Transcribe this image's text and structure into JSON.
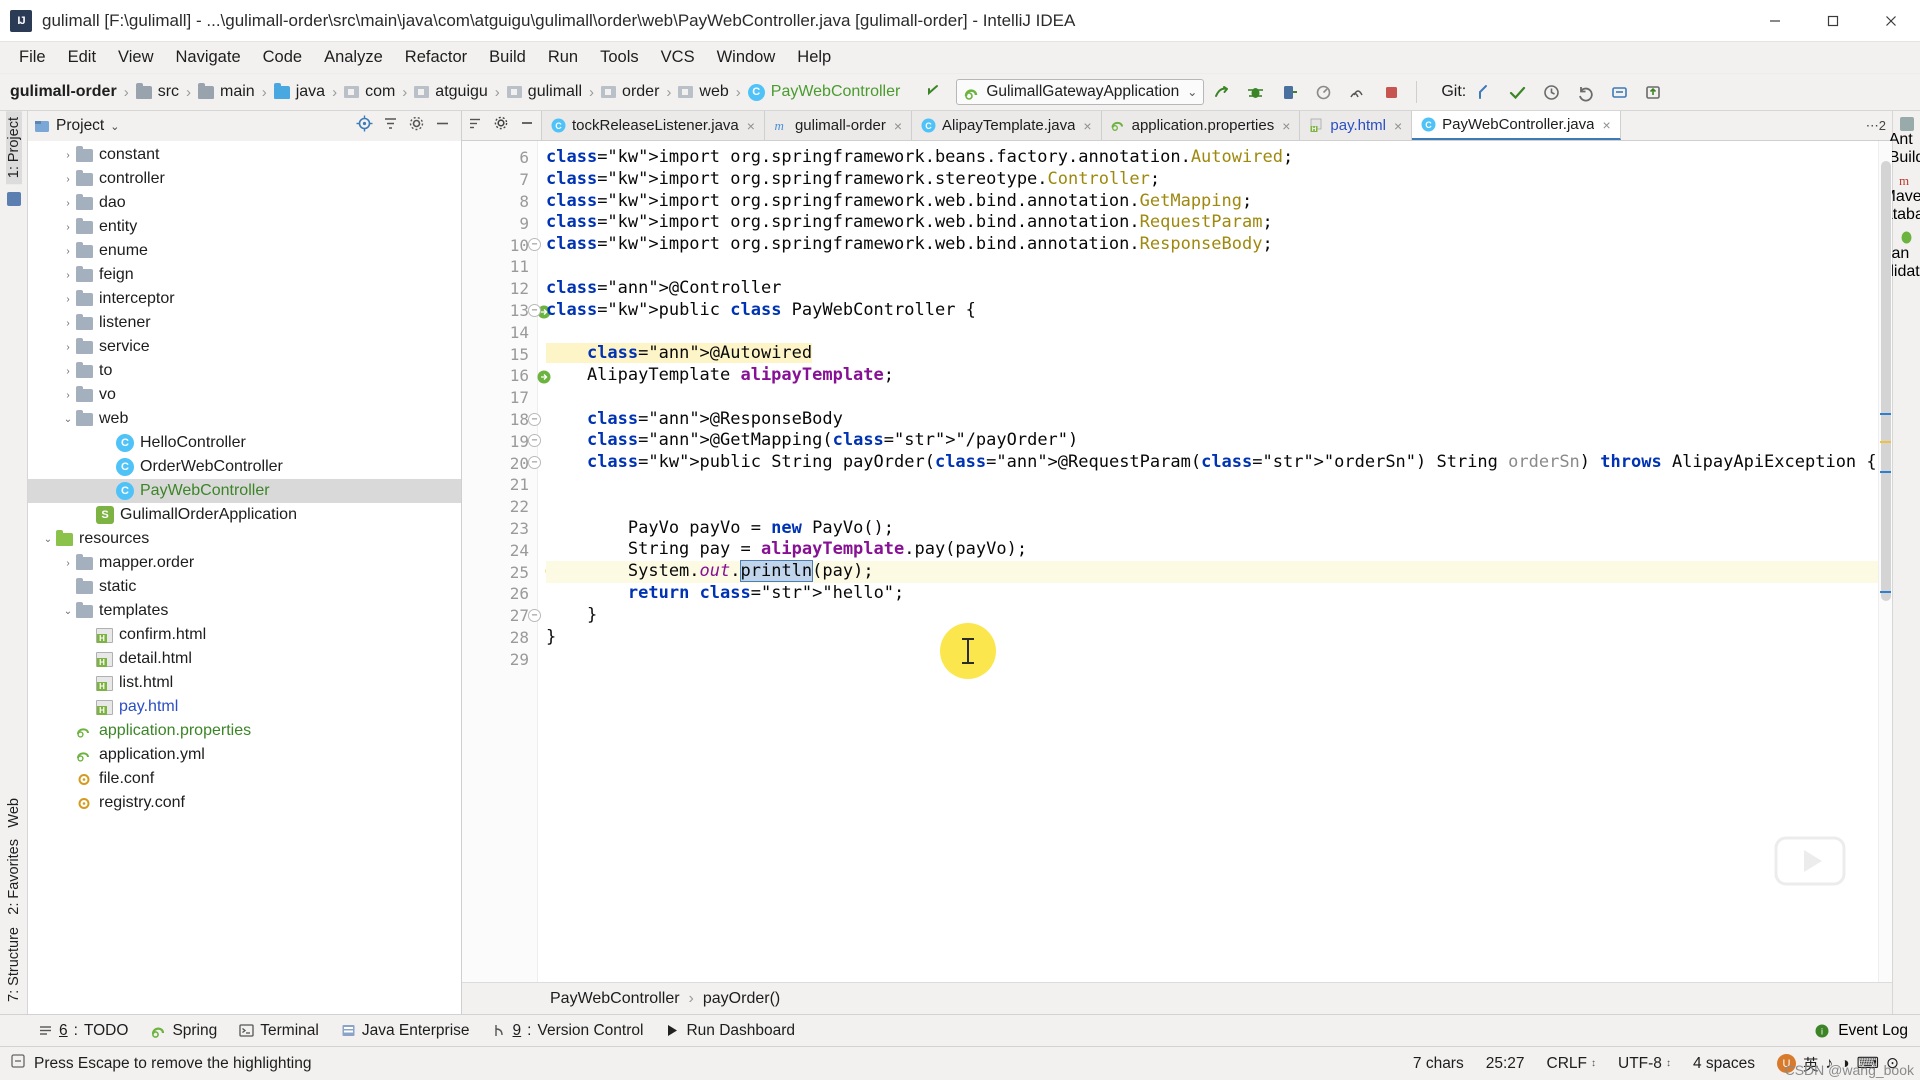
{
  "window": {
    "title": "gulimall [F:\\gulimall] - ...\\gulimall-order\\src\\main\\java\\com\\atguigu\\gulimall\\order\\web\\PayWebController.java [gulimall-order] - IntelliJ IDEA",
    "logo_text": "IJ",
    "minimize": "minimize-icon",
    "maximize": "maximize-icon",
    "close": "close-icon"
  },
  "menubar": {
    "items": [
      "File",
      "Edit",
      "View",
      "Navigate",
      "Code",
      "Analyze",
      "Refactor",
      "Build",
      "Run",
      "Tools",
      "VCS",
      "Window",
      "Help"
    ]
  },
  "navbar": {
    "crumbs": [
      {
        "label": "gulimall-order",
        "icon": "none",
        "bold": true
      },
      {
        "label": "src",
        "icon": "folder-src"
      },
      {
        "label": "main",
        "icon": "folder-src"
      },
      {
        "label": "java",
        "icon": "folder-blue"
      },
      {
        "label": "com",
        "icon": "package"
      },
      {
        "label": "atguigu",
        "icon": "package"
      },
      {
        "label": "gulimall",
        "icon": "package"
      },
      {
        "label": "order",
        "icon": "package"
      },
      {
        "label": "web",
        "icon": "package"
      },
      {
        "label": "PayWebController",
        "icon": "class",
        "cls": true
      }
    ],
    "run_config": {
      "name": "GulimallGatewayApplication",
      "icon": "spring-boot-icon",
      "chevron": "⌄"
    },
    "actions": [
      "run-icon",
      "debug-icon",
      "run-with-coverage-icon",
      "profile-icon",
      "build-icon",
      "stop-icon"
    ],
    "git_label": "Git:",
    "git_actions": [
      "update-project-icon",
      "commit-icon",
      "history-icon",
      "rollback-icon",
      "branch-icon",
      "push-icon"
    ]
  },
  "left_rail": {
    "top": [
      "1: Project"
    ],
    "bottom": [
      "★",
      "2: Favorites",
      "7: Structure",
      "Web"
    ]
  },
  "right_rail": {
    "items": [
      "Ant Build",
      "Maven",
      "Database",
      "Bean Validation"
    ]
  },
  "project_panel": {
    "title": "Project",
    "chevron": "⌄",
    "actions": [
      "locate-icon",
      "collapse-all-icon",
      "settings-icon",
      "hide-icon"
    ],
    "tree": [
      {
        "label": "constant",
        "icon": "folder",
        "arrow": "›",
        "indent": 4,
        "color": ""
      },
      {
        "label": "controller",
        "icon": "folder",
        "arrow": "›",
        "indent": 4,
        "color": ""
      },
      {
        "label": "dao",
        "icon": "folder",
        "arrow": "›",
        "indent": 4,
        "color": ""
      },
      {
        "label": "entity",
        "icon": "folder",
        "arrow": "›",
        "indent": 4,
        "color": ""
      },
      {
        "label": "enume",
        "icon": "folder",
        "arrow": "›",
        "indent": 4,
        "color": ""
      },
      {
        "label": "feign",
        "icon": "folder",
        "arrow": "›",
        "indent": 4,
        "color": ""
      },
      {
        "label": "interceptor",
        "icon": "folder",
        "arrow": "›",
        "indent": 4,
        "color": ""
      },
      {
        "label": "listener",
        "icon": "folder",
        "arrow": "›",
        "indent": 4,
        "color": ""
      },
      {
        "label": "service",
        "icon": "folder",
        "arrow": "›",
        "indent": 4,
        "color": ""
      },
      {
        "label": "to",
        "icon": "folder",
        "arrow": "›",
        "indent": 4,
        "color": ""
      },
      {
        "label": "vo",
        "icon": "folder",
        "arrow": "›",
        "indent": 4,
        "color": ""
      },
      {
        "label": "web",
        "icon": "folder",
        "arrow": "⌄",
        "indent": 4,
        "color": ""
      },
      {
        "label": "HelloController",
        "icon": "class",
        "arrow": "",
        "indent": 6,
        "color": ""
      },
      {
        "label": "OrderWebController",
        "icon": "class",
        "arrow": "",
        "indent": 6,
        "color": ""
      },
      {
        "label": "PayWebController",
        "icon": "class",
        "arrow": "",
        "indent": 6,
        "color": "green",
        "selected": true
      },
      {
        "label": "GulimallOrderApplication",
        "icon": "spring",
        "arrow": "",
        "indent": 5,
        "color": ""
      },
      {
        "label": "resources",
        "icon": "folder-green",
        "arrow": "⌄",
        "indent": 3,
        "color": ""
      },
      {
        "label": "mapper.order",
        "icon": "folder",
        "arrow": "›",
        "indent": 4,
        "color": ""
      },
      {
        "label": "static",
        "icon": "folder",
        "arrow": "",
        "indent": 4,
        "color": ""
      },
      {
        "label": "templates",
        "icon": "folder",
        "arrow": "⌄",
        "indent": 4,
        "color": ""
      },
      {
        "label": "confirm.html",
        "icon": "html",
        "arrow": "",
        "indent": 5,
        "color": ""
      },
      {
        "label": "detail.html",
        "icon": "html",
        "arrow": "",
        "indent": 5,
        "color": ""
      },
      {
        "label": "list.html",
        "icon": "html",
        "arrow": "",
        "indent": 5,
        "color": ""
      },
      {
        "label": "pay.html",
        "icon": "html",
        "arrow": "",
        "indent": 5,
        "color": "blue"
      },
      {
        "label": "application.properties",
        "icon": "props",
        "arrow": "",
        "indent": 4,
        "color": "green"
      },
      {
        "label": "application.yml",
        "icon": "props",
        "arrow": "",
        "indent": 4,
        "color": ""
      },
      {
        "label": "file.conf",
        "icon": "conf",
        "arrow": "",
        "indent": 4,
        "color": ""
      },
      {
        "label": "registry.conf",
        "icon": "conf",
        "arrow": "",
        "indent": 4,
        "color": ""
      }
    ]
  },
  "editor": {
    "tabs": [
      {
        "label": "tockReleaseListener.java",
        "icon": "class",
        "active": false,
        "truncated": true
      },
      {
        "label": "gulimall-order",
        "icon": "maven",
        "active": false
      },
      {
        "label": "AlipayTemplate.java",
        "icon": "class",
        "active": false
      },
      {
        "label": "application.properties",
        "icon": "spring-props",
        "active": false
      },
      {
        "label": "pay.html",
        "icon": "html",
        "active": false,
        "blue": true
      },
      {
        "label": "PayWebController.java",
        "icon": "class",
        "active": true
      }
    ],
    "tab_overflow": "⋯2",
    "close_glyph": "×",
    "first_line_number": 6,
    "lines": [
      {
        "n": 6,
        "text": "import org.springframework.beans.factory.annotation.Autowired;"
      },
      {
        "n": 7,
        "text": "import org.springframework.stereotype.Controller;"
      },
      {
        "n": 8,
        "text": "import org.springframework.web.bind.annotation.GetMapping;"
      },
      {
        "n": 9,
        "text": "import org.springframework.web.bind.annotation.RequestParam;"
      },
      {
        "n": 10,
        "text": "import org.springframework.web.bind.annotation.ResponseBody;"
      },
      {
        "n": 11,
        "text": ""
      },
      {
        "n": 12,
        "text": "@Controller"
      },
      {
        "n": 13,
        "text": "public class PayWebController {"
      },
      {
        "n": 14,
        "text": ""
      },
      {
        "n": 15,
        "text": "    @Autowired"
      },
      {
        "n": 16,
        "text": "    AlipayTemplate alipayTemplate;"
      },
      {
        "n": 17,
        "text": ""
      },
      {
        "n": 18,
        "text": "    @ResponseBody"
      },
      {
        "n": 19,
        "text": "    @GetMapping(\"/payOrder\")"
      },
      {
        "n": 20,
        "text": "    public String payOrder(@RequestParam(\"orderSn\") String orderSn) throws AlipayApiException {"
      },
      {
        "n": 21,
        "text": ""
      },
      {
        "n": 22,
        "text": ""
      },
      {
        "n": 23,
        "text": "        PayVo payVo = new PayVo();"
      },
      {
        "n": 24,
        "text": "        String pay = alipayTemplate.pay(payVo);"
      },
      {
        "n": 25,
        "text": "        System.out.println(pay);"
      },
      {
        "n": 26,
        "text": "        return \"hello\";"
      },
      {
        "n": 27,
        "text": "    }"
      },
      {
        "n": 28,
        "text": "}"
      },
      {
        "n": 29,
        "text": ""
      }
    ],
    "selected_token": "println",
    "highlighted_line": 25,
    "breadcrumb": [
      "PayWebController",
      "payOrder()"
    ],
    "breadcrumb_sep": "›"
  },
  "toolwindow_bar": {
    "items": [
      {
        "num": "6",
        "label": "TODO",
        "icon": "todo-icon"
      },
      {
        "num": "",
        "label": "Spring",
        "icon": "spring-icon"
      },
      {
        "num": "",
        "label": "Terminal",
        "icon": "terminal-icon"
      },
      {
        "num": "",
        "label": "Java Enterprise",
        "icon": "java-ee-icon"
      },
      {
        "num": "9",
        "label": "Version Control",
        "icon": "vcs-icon"
      },
      {
        "num": "",
        "label": "Run Dashboard",
        "icon": "run-dashboard-icon"
      }
    ],
    "event_log": "Event Log"
  },
  "statusbar": {
    "message": "Press Escape to remove the highlighting",
    "chars": "7 chars",
    "caret": "25:27",
    "line_sep": "CRLF",
    "encoding": "UTF-8",
    "indent": "4 spaces",
    "ime": [
      "英",
      "♪",
      "◑",
      "⌨",
      "⊙"
    ],
    "lock_icon": "read-only-icon"
  },
  "watermark": "CSDN @wang_book",
  "colors": {
    "accent": "#3d7ab8",
    "keyword": "#0033b3",
    "string": "#067d17",
    "annotation": "#9e880d",
    "field": "#871094",
    "selection": "#c0d4ec",
    "line_highlight": "#fcfae3",
    "tree_selected": "#d9d9d9"
  }
}
